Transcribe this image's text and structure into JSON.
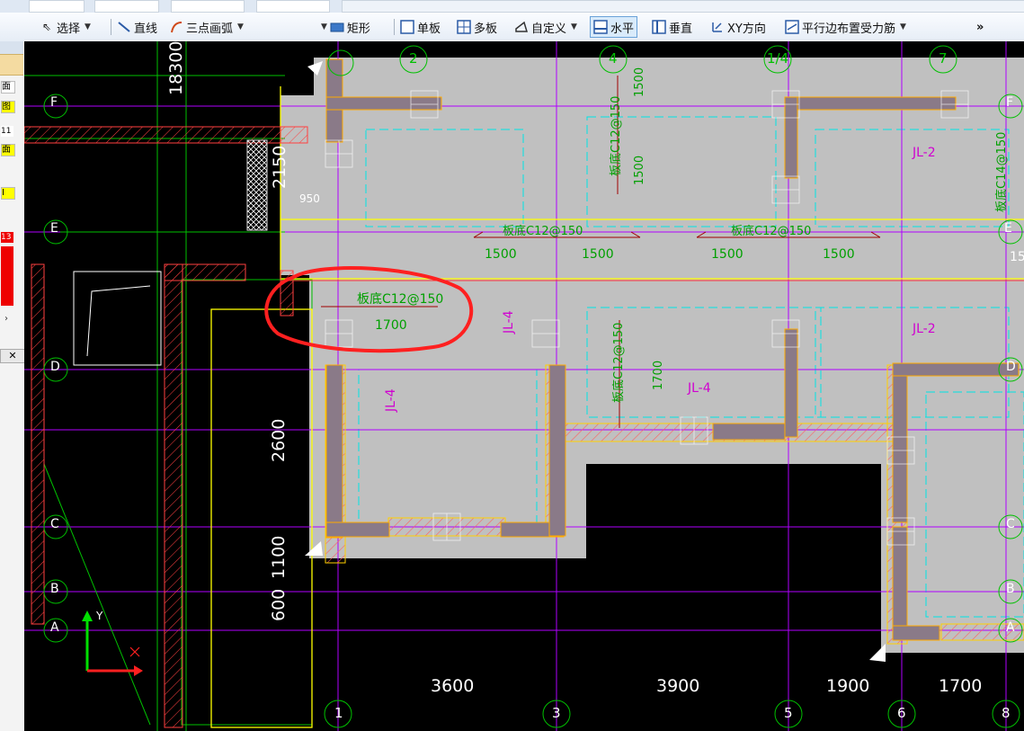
{
  "toolbar": {
    "items": [
      {
        "label": "选择",
        "icon": "cursor-arrow-icon"
      },
      {
        "label": "直线",
        "icon": "line-icon"
      },
      {
        "label": "三点画弧",
        "icon": "arc-icon"
      },
      {
        "label": "矩形",
        "icon": "rectangle-icon"
      },
      {
        "label": "单板",
        "icon": "single-slab-icon"
      },
      {
        "label": "多板",
        "icon": "multi-slab-icon"
      },
      {
        "label": "自定义",
        "icon": "custom-shape-icon"
      },
      {
        "label": "水平",
        "icon": "horizontal-icon",
        "active": true
      },
      {
        "label": "垂直",
        "icon": "vertical-icon"
      },
      {
        "label": "XY方向",
        "icon": "xy-direction-icon"
      },
      {
        "label": "平行边布置受力筋",
        "icon": "parallel-rebar-icon"
      }
    ],
    "overflow": "»"
  },
  "left_panel": {
    "labels": [
      "面",
      "图",
      "11",
      "面",
      "I",
      "13"
    ]
  },
  "drawing": {
    "axes_letters": [
      "F",
      "E",
      "D",
      "C",
      "B",
      "A"
    ],
    "axes_numbers_top": [
      "2",
      "4",
      "1/4",
      "7"
    ],
    "axes_numbers_bottom": [
      "1",
      "3",
      "5",
      "6",
      "8"
    ],
    "dims_bottom": [
      "3600",
      "3900",
      "1900",
      "1700"
    ],
    "dims_left": [
      "18300",
      "2150",
      "2600",
      "1100",
      "600"
    ],
    "dim_950": "950",
    "dim_top_1500": "1500",
    "dim_1500_row": [
      "1500",
      "1500",
      "1500",
      "1500"
    ],
    "dim_1700": "1700",
    "dim_1500_vert": "1500",
    "dim_1700_vert": "1700",
    "rebar": {
      "bottom_c12": "板底C12@150",
      "bottom_c14": "板底C14@150"
    },
    "beams": {
      "jl2": "JL-2",
      "jl4": "JL-4"
    },
    "axis_labels": {
      "x": "X",
      "y": "Y"
    },
    "partial_right": "15"
  }
}
